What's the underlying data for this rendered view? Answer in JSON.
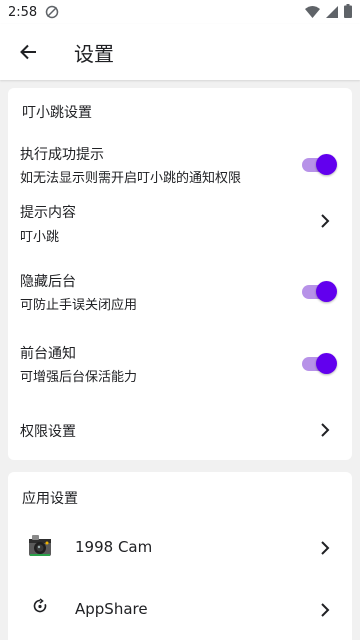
{
  "status_bar": {
    "time": "2:58",
    "left_icons": [
      "dnd-off-icon"
    ],
    "right_icons": [
      "wifi-icon",
      "signal-icon",
      "battery-icon"
    ]
  },
  "app_bar": {
    "back_icon": "arrow-back-icon",
    "title": "设置"
  },
  "xiaotiao_section": {
    "title": "叮小跳设置",
    "items": [
      {
        "title": "执行成功提示",
        "subtitle": "如无法显示则需开启叮小跳的通知权限",
        "control": "switch",
        "checked": true
      },
      {
        "title": "提示内容",
        "subtitle": "叮小跳",
        "control": "chevron"
      },
      {
        "title": "隐藏后台",
        "subtitle": "可防止手误关闭应用",
        "control": "switch",
        "checked": true
      },
      {
        "title": "前台通知",
        "subtitle": "可增强后台保活能力",
        "control": "switch",
        "checked": true
      },
      {
        "title": "权限设置",
        "control": "chevron"
      }
    ]
  },
  "app_section": {
    "title": "应用设置",
    "items": [
      {
        "name": "1998 Cam",
        "icon": "camera-app-icon"
      },
      {
        "name": "AppShare",
        "icon": "appshare-icon"
      }
    ]
  },
  "colors": {
    "accent": "#6200ee",
    "accent_track": "#b792e8",
    "background": "#f1f1f1",
    "card": "#ffffff"
  }
}
